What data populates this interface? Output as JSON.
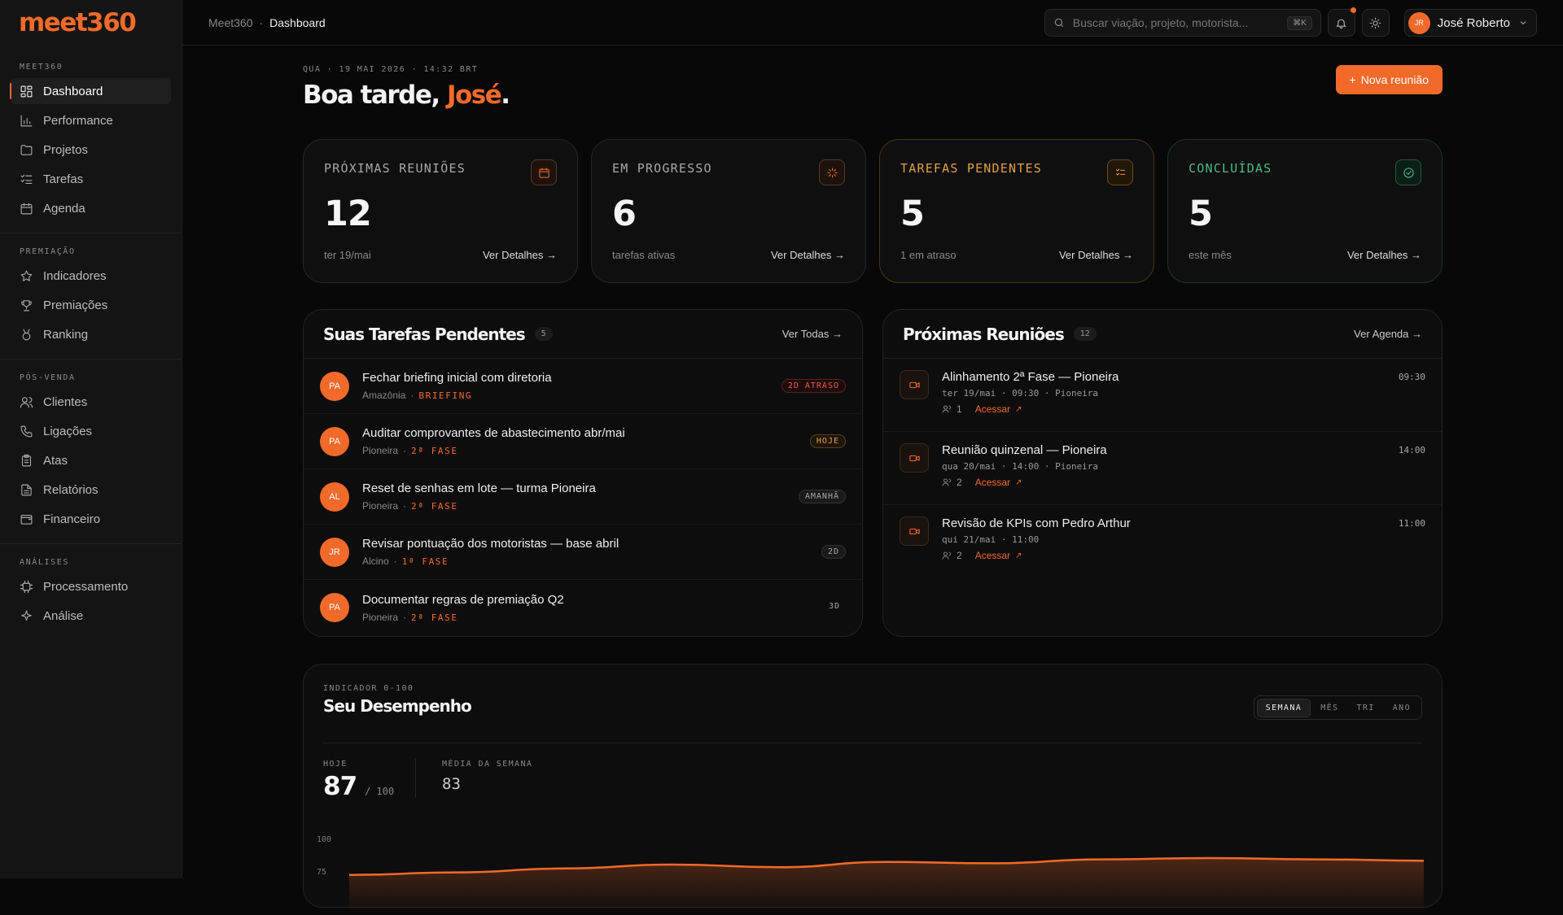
{
  "brand": {
    "logo": "meet360"
  },
  "nav": {
    "sections": [
      {
        "title": "MEET360",
        "items": [
          "Dashboard",
          "Performance",
          "Projetos",
          "Tarefas",
          "Agenda"
        ]
      },
      {
        "title": "PREMIAÇÃO",
        "items": [
          "Indicadores",
          "Premiações",
          "Ranking"
        ]
      },
      {
        "title": "PÓS-VENDA",
        "items": [
          "Clientes",
          "Ligações",
          "Atas",
          "Relatórios",
          "Financeiro"
        ]
      },
      {
        "title": "ANÁLISES",
        "items": [
          "Processamento",
          "Análise"
        ]
      }
    ],
    "active": "Dashboard"
  },
  "topbar": {
    "breadcrumb": [
      "Meet360",
      "Dashboard"
    ],
    "search_placeholder": "Buscar viação, projeto, motorista...",
    "search_shortcut": "⌘K",
    "user_initials": "JR",
    "user_name": "José Roberto"
  },
  "header": {
    "date": "QUA · 19 MAI 2026 · 14:32 BRT",
    "greeting": "Boa tarde, ",
    "name": "José",
    "punct": ".",
    "new_button": "Nova reunião"
  },
  "stats": [
    {
      "title": "PRÓXIMAS REUNIÕES",
      "value": "12",
      "sub": "ter 19/mai",
      "link": "Ver Detalhes →",
      "icon": "calendar-icon"
    },
    {
      "title": "EM PROGRESSO",
      "value": "6",
      "sub": "tarefas ativas",
      "link": "Ver Detalhes →",
      "icon": "loader-icon"
    },
    {
      "title": "TAREFAS PENDENTES",
      "value": "5",
      "sub": "1 em atraso",
      "link": "Ver Detalhes →",
      "icon": "list-check-icon"
    },
    {
      "title": "CONCLUÍDAS",
      "value": "5",
      "sub": "este mês",
      "link": "Ver Detalhes →",
      "icon": "check-circle-icon"
    }
  ],
  "tasks": {
    "title": "Suas Tarefas Pendentes",
    "count": "5",
    "more": "Ver Todas →",
    "items": [
      {
        "initials": "PA",
        "title": "Fechar briefing inicial com diretoria",
        "client": "Amazônia",
        "phase": "BRIEFING",
        "badge": "2D ATRASO"
      },
      {
        "initials": "PA",
        "title": "Auditar comprovantes de abastecimento abr/mai",
        "client": "Pioneira",
        "phase": "2ª FASE",
        "badge": "HOJE"
      },
      {
        "initials": "AL",
        "title": "Reset de senhas em lote — turma Pioneira",
        "client": "Pioneira",
        "phase": "2ª FASE",
        "badge": "AMANHÃ"
      },
      {
        "initials": "JR",
        "title": "Revisar pontuação dos motoristas — base abril",
        "client": "Alcino",
        "phase": "1ª FASE",
        "badge": "2D"
      },
      {
        "initials": "PA",
        "title": "Documentar regras de premiação Q2",
        "client": "Pioneira",
        "phase": "2ª FASE",
        "badge": "3D"
      }
    ]
  },
  "meetings": {
    "title": "Próximas Reuniões",
    "count": "12",
    "more": "Ver Agenda →",
    "items": [
      {
        "title": "Alinhamento 2ª Fase — Pioneira",
        "when": "ter 19/mai · 09:30 · Pioneira",
        "people": "1",
        "access": "Acessar",
        "time": "09:30"
      },
      {
        "title": "Reunião quinzenal — Pioneira",
        "when": "qua 20/mai · 14:00 · Pioneira",
        "people": "2",
        "access": "Acessar",
        "time": "14:00"
      },
      {
        "title": "Revisão de KPIs com Pedro Arthur",
        "when": "qui 21/mai · 11:00",
        "people": "2",
        "access": "Acessar",
        "time": "11:00"
      }
    ]
  },
  "performance": {
    "indicator": "INDICADOR 0-100",
    "title": "Seu Desempenho",
    "ranges": [
      "SEMANA",
      "MÊS",
      "TRI",
      "ANO"
    ],
    "active_range": "SEMANA",
    "today_label": "HOJE",
    "today_value": "87",
    "today_max": "/ 100",
    "week_label": "MÉDIA DA SEMANA",
    "week_value": "83"
  },
  "chart_data": {
    "type": "area",
    "yticks": [
      "100",
      "75"
    ],
    "ylim": [
      0,
      100
    ],
    "values": [
      72,
      74,
      77,
      80,
      78,
      82,
      81,
      84,
      85,
      84,
      83
    ],
    "color": "#f26a2a"
  }
}
